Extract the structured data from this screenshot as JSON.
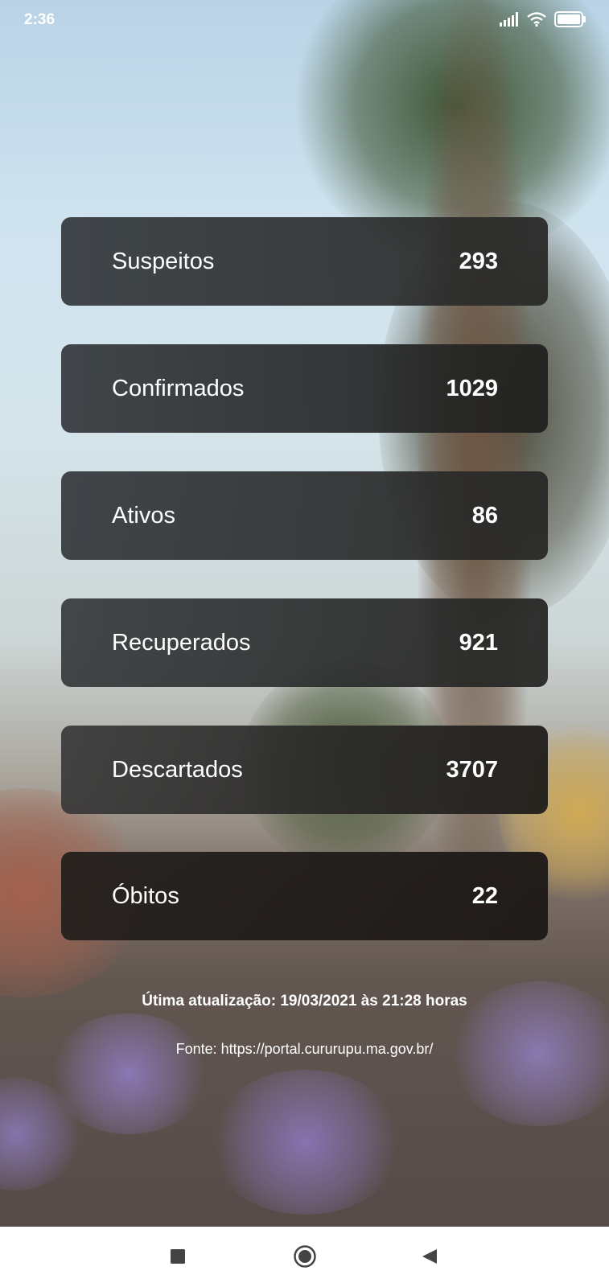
{
  "status_bar": {
    "time": "2:36",
    "icons": [
      "signal-icon",
      "wifi-icon",
      "battery-icon"
    ]
  },
  "cards": [
    {
      "label": "Suspeitos",
      "value": "293"
    },
    {
      "label": "Confirmados",
      "value": "1029"
    },
    {
      "label": "Ativos",
      "value": "86"
    },
    {
      "label": "Recuperados",
      "value": "921"
    },
    {
      "label": "Descartados",
      "value": "3707"
    },
    {
      "label": "Óbitos",
      "value": "22"
    }
  ],
  "footer": {
    "update": "Útima atualização: 19/03/2021 às 21:28 horas",
    "source": "Fonte: https://portal.cururupu.ma.gov.br/"
  },
  "nav_bar": {
    "icons": [
      "recents-icon",
      "home-icon",
      "back-icon"
    ]
  }
}
